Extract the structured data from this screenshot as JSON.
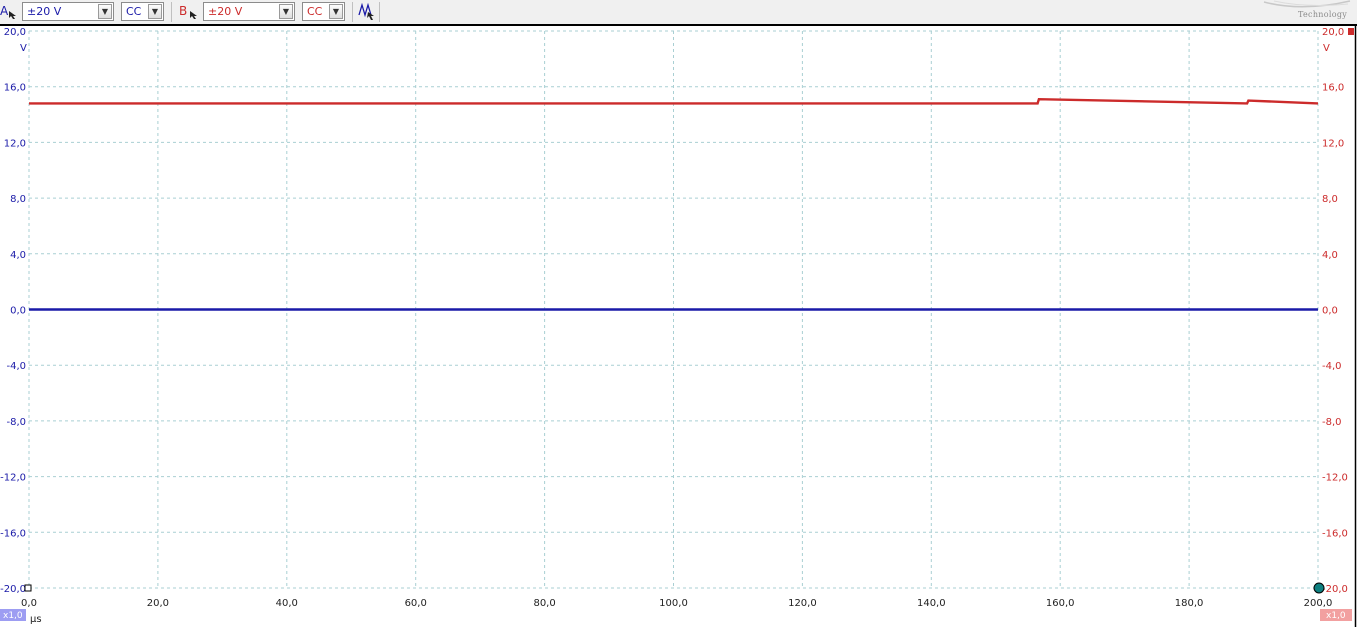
{
  "toolbar": {
    "channel_a": {
      "label": "A",
      "range": "±20 V",
      "coupling": "CC",
      "color": "#1a1aa8"
    },
    "channel_b": {
      "label": "B",
      "range": "±20 V",
      "coupling": "CC",
      "color": "#cc2b2b"
    },
    "trigger_icon": "waveform-icon",
    "logo_text": "Technology"
  },
  "chart_data": {
    "type": "line",
    "x_unit": "µs",
    "xlim": [
      0,
      200
    ],
    "x_ticks": [
      "0,0",
      "20,0",
      "40,0",
      "60,0",
      "80,0",
      "100,0",
      "120,0",
      "140,0",
      "160,0",
      "180,0",
      "200,0"
    ],
    "left_axis": {
      "unit": "V",
      "ylim": [
        -20,
        20
      ],
      "color": "#1a1aa8",
      "ticks": [
        "20,0",
        "16,0",
        "12,0",
        "8,0",
        "4,0",
        "0,0",
        "-4,0",
        "-8,0",
        "-12,0",
        "-16,0",
        "-20,0"
      ]
    },
    "right_axis": {
      "unit": "V",
      "ylim": [
        -20,
        20
      ],
      "color": "#cc2b2b",
      "ticks": [
        "20,0",
        "16,0",
        "12,0",
        "8,0",
        "4,0",
        "0,0",
        "-4,0",
        "-8,0",
        "-12,0",
        "-16,0",
        "-20,0"
      ]
    },
    "grid": true,
    "series": [
      {
        "channel": "A",
        "color": "#1a1aa8",
        "x": [
          0,
          200
        ],
        "y": [
          0.0,
          0.0
        ]
      },
      {
        "channel": "B",
        "color": "#cc2b2b",
        "x": [
          0,
          156.5,
          156.7,
          189.0,
          189.2,
          200
        ],
        "y": [
          14.8,
          14.8,
          15.1,
          14.8,
          15.0,
          14.8
        ]
      }
    ],
    "scale_labels": {
      "left": "x1,0",
      "right": "x1,0"
    }
  }
}
